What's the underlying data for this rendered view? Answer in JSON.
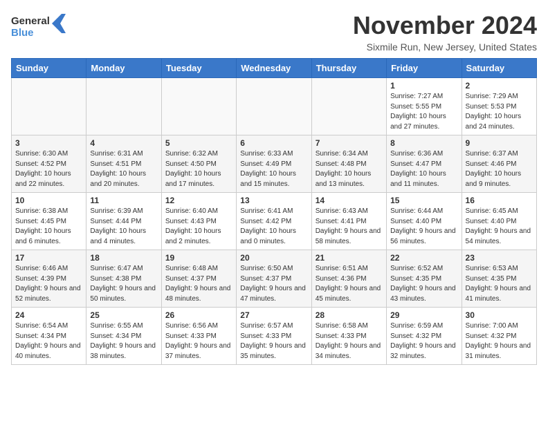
{
  "header": {
    "logo_line1": "General",
    "logo_line2": "Blue",
    "month": "November 2024",
    "location": "Sixmile Run, New Jersey, United States"
  },
  "weekdays": [
    "Sunday",
    "Monday",
    "Tuesday",
    "Wednesday",
    "Thursday",
    "Friday",
    "Saturday"
  ],
  "rows": [
    [
      {
        "day": "",
        "info": ""
      },
      {
        "day": "",
        "info": ""
      },
      {
        "day": "",
        "info": ""
      },
      {
        "day": "",
        "info": ""
      },
      {
        "day": "",
        "info": ""
      },
      {
        "day": "1",
        "info": "Sunrise: 7:27 AM\nSunset: 5:55 PM\nDaylight: 10 hours and 27 minutes."
      },
      {
        "day": "2",
        "info": "Sunrise: 7:29 AM\nSunset: 5:53 PM\nDaylight: 10 hours and 24 minutes."
      }
    ],
    [
      {
        "day": "3",
        "info": "Sunrise: 6:30 AM\nSunset: 4:52 PM\nDaylight: 10 hours and 22 minutes."
      },
      {
        "day": "4",
        "info": "Sunrise: 6:31 AM\nSunset: 4:51 PM\nDaylight: 10 hours and 20 minutes."
      },
      {
        "day": "5",
        "info": "Sunrise: 6:32 AM\nSunset: 4:50 PM\nDaylight: 10 hours and 17 minutes."
      },
      {
        "day": "6",
        "info": "Sunrise: 6:33 AM\nSunset: 4:49 PM\nDaylight: 10 hours and 15 minutes."
      },
      {
        "day": "7",
        "info": "Sunrise: 6:34 AM\nSunset: 4:48 PM\nDaylight: 10 hours and 13 minutes."
      },
      {
        "day": "8",
        "info": "Sunrise: 6:36 AM\nSunset: 4:47 PM\nDaylight: 10 hours and 11 minutes."
      },
      {
        "day": "9",
        "info": "Sunrise: 6:37 AM\nSunset: 4:46 PM\nDaylight: 10 hours and 9 minutes."
      }
    ],
    [
      {
        "day": "10",
        "info": "Sunrise: 6:38 AM\nSunset: 4:45 PM\nDaylight: 10 hours and 6 minutes."
      },
      {
        "day": "11",
        "info": "Sunrise: 6:39 AM\nSunset: 4:44 PM\nDaylight: 10 hours and 4 minutes."
      },
      {
        "day": "12",
        "info": "Sunrise: 6:40 AM\nSunset: 4:43 PM\nDaylight: 10 hours and 2 minutes."
      },
      {
        "day": "13",
        "info": "Sunrise: 6:41 AM\nSunset: 4:42 PM\nDaylight: 10 hours and 0 minutes."
      },
      {
        "day": "14",
        "info": "Sunrise: 6:43 AM\nSunset: 4:41 PM\nDaylight: 9 hours and 58 minutes."
      },
      {
        "day": "15",
        "info": "Sunrise: 6:44 AM\nSunset: 4:40 PM\nDaylight: 9 hours and 56 minutes."
      },
      {
        "day": "16",
        "info": "Sunrise: 6:45 AM\nSunset: 4:40 PM\nDaylight: 9 hours and 54 minutes."
      }
    ],
    [
      {
        "day": "17",
        "info": "Sunrise: 6:46 AM\nSunset: 4:39 PM\nDaylight: 9 hours and 52 minutes."
      },
      {
        "day": "18",
        "info": "Sunrise: 6:47 AM\nSunset: 4:38 PM\nDaylight: 9 hours and 50 minutes."
      },
      {
        "day": "19",
        "info": "Sunrise: 6:48 AM\nSunset: 4:37 PM\nDaylight: 9 hours and 48 minutes."
      },
      {
        "day": "20",
        "info": "Sunrise: 6:50 AM\nSunset: 4:37 PM\nDaylight: 9 hours and 47 minutes."
      },
      {
        "day": "21",
        "info": "Sunrise: 6:51 AM\nSunset: 4:36 PM\nDaylight: 9 hours and 45 minutes."
      },
      {
        "day": "22",
        "info": "Sunrise: 6:52 AM\nSunset: 4:35 PM\nDaylight: 9 hours and 43 minutes."
      },
      {
        "day": "23",
        "info": "Sunrise: 6:53 AM\nSunset: 4:35 PM\nDaylight: 9 hours and 41 minutes."
      }
    ],
    [
      {
        "day": "24",
        "info": "Sunrise: 6:54 AM\nSunset: 4:34 PM\nDaylight: 9 hours and 40 minutes."
      },
      {
        "day": "25",
        "info": "Sunrise: 6:55 AM\nSunset: 4:34 PM\nDaylight: 9 hours and 38 minutes."
      },
      {
        "day": "26",
        "info": "Sunrise: 6:56 AM\nSunset: 4:33 PM\nDaylight: 9 hours and 37 minutes."
      },
      {
        "day": "27",
        "info": "Sunrise: 6:57 AM\nSunset: 4:33 PM\nDaylight: 9 hours and 35 minutes."
      },
      {
        "day": "28",
        "info": "Sunrise: 6:58 AM\nSunset: 4:33 PM\nDaylight: 9 hours and 34 minutes."
      },
      {
        "day": "29",
        "info": "Sunrise: 6:59 AM\nSunset: 4:32 PM\nDaylight: 9 hours and 32 minutes."
      },
      {
        "day": "30",
        "info": "Sunrise: 7:00 AM\nSunset: 4:32 PM\nDaylight: 9 hours and 31 minutes."
      }
    ]
  ]
}
